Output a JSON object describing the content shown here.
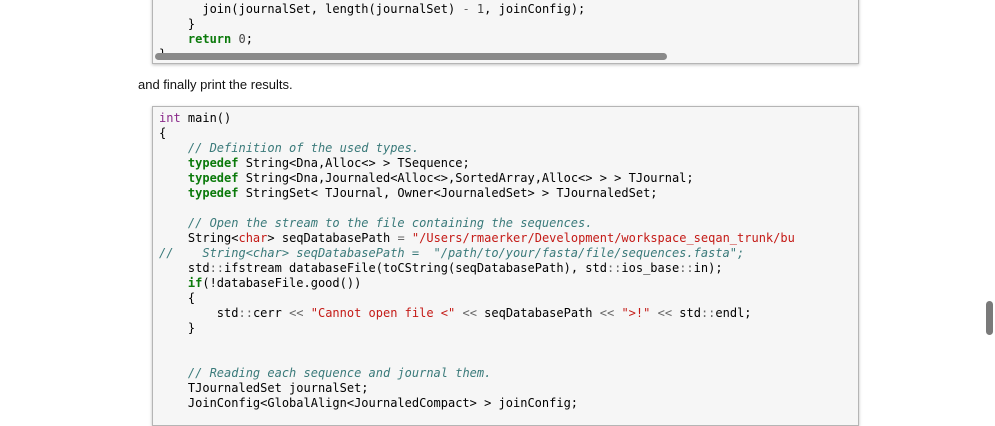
{
  "snippet_1": {
    "lines": [
      "      join(journalSet, length(journalSet) - 1, joinConfig);",
      "    }",
      "    return 0;",
      "}"
    ]
  },
  "prose": {
    "text": "and finally print the results."
  },
  "snippet_2": {
    "lines": [
      "int main()",
      "{",
      "    // Definition of the used types.",
      "    typedef String<Dna,Alloc<> > TSequence;",
      "    typedef String<Dna,Journaled<Alloc<>,SortedArray,Alloc<> > > TJournal;",
      "    typedef StringSet< TJournal, Owner<JournaledSet> > TJournaledSet;",
      "",
      "    // Open the stream to the file containing the sequences.",
      "    String<char> seqDatabasePath = \"/Users/rmaerker/Development/workspace_seqan_trunk/bu",
      "//    String<char> seqDatabasePath =  \"/path/to/your/fasta/file/sequences.fasta\";",
      "    std::ifstream databaseFile(toCString(seqDatabasePath), std::ios_base::in);",
      "    if(!databaseFile.good())",
      "    {",
      "        std::cerr << \"Cannot open file <\" << seqDatabasePath << \">!\" << std::endl;",
      "    }",
      "",
      "",
      "    // Reading each sequence and journal them.",
      "    TJournaledSet journalSet;",
      "    JoinConfig<GlobalAlign<JournaledCompact> > joinConfig;"
    ]
  }
}
